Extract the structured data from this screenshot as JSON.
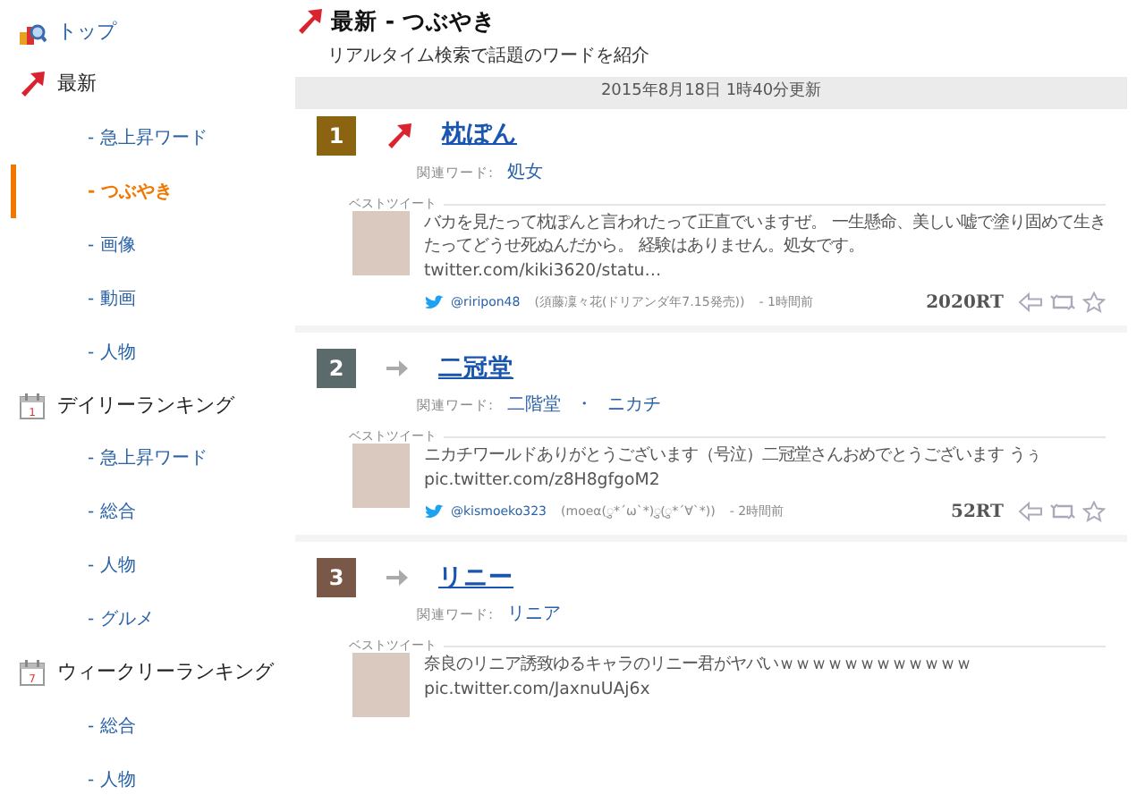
{
  "sidebar": {
    "items": [
      {
        "label": "トップ",
        "kind": "top",
        "selected": false
      },
      {
        "label": "最新",
        "kind": "trend",
        "selected": false,
        "children": [
          {
            "label": "- 急上昇ワード",
            "selected": false
          },
          {
            "label": "- つぶやき",
            "selected": true
          },
          {
            "label": "- 画像",
            "selected": false
          },
          {
            "label": "- 動画",
            "selected": false
          },
          {
            "label": "- 人物",
            "selected": false
          }
        ]
      },
      {
        "label": "デイリーランキング",
        "kind": "calendar",
        "calendar_day": "1",
        "selected": false,
        "children": [
          {
            "label": "- 急上昇ワード",
            "selected": false
          },
          {
            "label": "- 総合",
            "selected": false
          },
          {
            "label": "- 人物",
            "selected": false
          },
          {
            "label": "- グルメ",
            "selected": false
          }
        ]
      },
      {
        "label": "ウィークリーランキング",
        "kind": "calendar",
        "calendar_day": "7",
        "selected": false,
        "children": [
          {
            "label": "- 総合",
            "selected": false
          },
          {
            "label": "- 人物",
            "selected": false
          }
        ]
      }
    ]
  },
  "header": {
    "title": "最新 - つぶやき",
    "subtitle": "リアルタイム検索で話題のワードを紹介",
    "updated": "2015年8月18日 1時40分更新"
  },
  "ranking": [
    {
      "rank": "1",
      "color": "#8a6410",
      "kind": "up",
      "word": "枕ぽん",
      "related_label": "関連ワード:",
      "related": [
        "処女"
      ],
      "tweet_label": "ベストツイート",
      "text": "バカを見たって枕ぽんと言われたって正直でいますぜ。 一生懸命、美しい嘘で塗り固めて生きたってどうせ死ぬんだから。 経験はありません。処女です。 ",
      "link": "twitter.com/kiki3620/statu…",
      "handle": "@riripon48",
      "user": "(須藤凜々花(ドリアンダ年7.15発売))",
      "time": "- 1時間前",
      "rt": "2020RT"
    },
    {
      "rank": "2",
      "color": "#5b6b6b",
      "kind": "flat",
      "word": "二冠堂",
      "related_label": "関連ワード:",
      "related": [
        "二階堂",
        "・",
        "ニカチ"
      ],
      "tweet_label": "ベストツイート",
      "text": "ニカチワールドありがとうございます（号泣）二冠堂さんおめでとうございます うぅ ",
      "link": "pic.twitter.com/z8H8gfgoM2",
      "handle": "@kismoeko323",
      "user": "(moeα(ु*´ω`*)ु(ु*´∀`*))",
      "time": "- 2時間前",
      "rt": "52RT"
    },
    {
      "rank": "3",
      "color": "#7a5848",
      "kind": "flat",
      "word": "リニー",
      "related_label": "関連ワード:",
      "related": [
        "リニア"
      ],
      "tweet_label": "ベストツイート",
      "text": "奈良のリニア誘致ゆるキャラのリニー君がヤバいｗｗｗｗｗｗｗｗｗｗｗｗ ",
      "link": "pic.twitter.com/JaxnuUAj6x"
    }
  ]
}
